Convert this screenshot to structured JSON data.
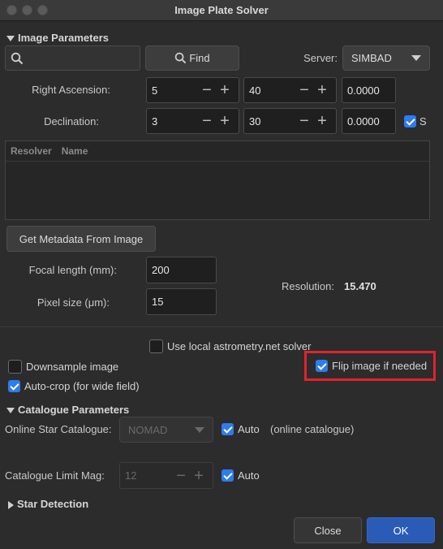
{
  "window": {
    "title": "Image Plate Solver"
  },
  "image_params": {
    "header": "Image Parameters",
    "search_placeholder": "",
    "find_label": "Find",
    "server_label": "Server:",
    "server_value": "SIMBAD",
    "ra_label": "Right Ascension:",
    "ra": {
      "h": "5",
      "m": "40",
      "s": "0.0000"
    },
    "dec_label": "Declination:",
    "dec": {
      "d": "3",
      "m": "30",
      "s": "0.0000"
    },
    "south_label": "S",
    "table_headers": [
      "Resolver",
      "Name"
    ],
    "metadata_button": "Get Metadata From Image",
    "focal_label": "Focal length (mm):",
    "focal_value": "200",
    "pixel_label": "Pixel size (μm):",
    "pixel_value": "15",
    "resolution_label": "Resolution:",
    "resolution_value": "15.470"
  },
  "options": {
    "local_solver": "Use local astrometry.net solver",
    "downsample": "Downsample image",
    "flip": "Flip image if needed",
    "autocrop": "Auto-crop (for wide field)"
  },
  "catalogue": {
    "header": "Catalogue Parameters",
    "online_label": "Online Star Catalogue:",
    "online_value": "NOMAD",
    "auto_label": "Auto",
    "online_note": "(online catalogue)",
    "limit_label": "Catalogue Limit Mag:",
    "limit_value": "12",
    "auto2_label": "Auto"
  },
  "star_detection": {
    "header": "Star Detection"
  },
  "footer": {
    "close": "Close",
    "ok": "OK"
  },
  "colors": {
    "accent": "#2f7bf0",
    "highlight": "#e0242b"
  }
}
